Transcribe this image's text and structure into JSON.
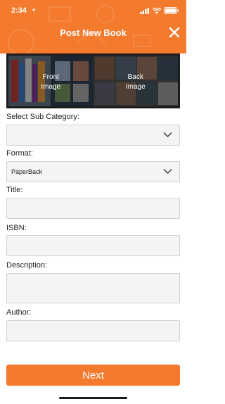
{
  "status": {
    "time": "2:34"
  },
  "header": {
    "title": "Post New Book"
  },
  "images": {
    "front_label": "Front\nImage",
    "back_label": "Back\nImage"
  },
  "form": {
    "sub_category_label": "Select Sub Category:",
    "sub_category_value": "",
    "format_label": "Format:",
    "format_value": "PaperBack",
    "title_label": "Title:",
    "isbn_label": "ISBN:",
    "description_label": "Description:",
    "author_label": "Author:"
  },
  "next_label": "Next",
  "colors": {
    "accent": "#f47a2d"
  }
}
